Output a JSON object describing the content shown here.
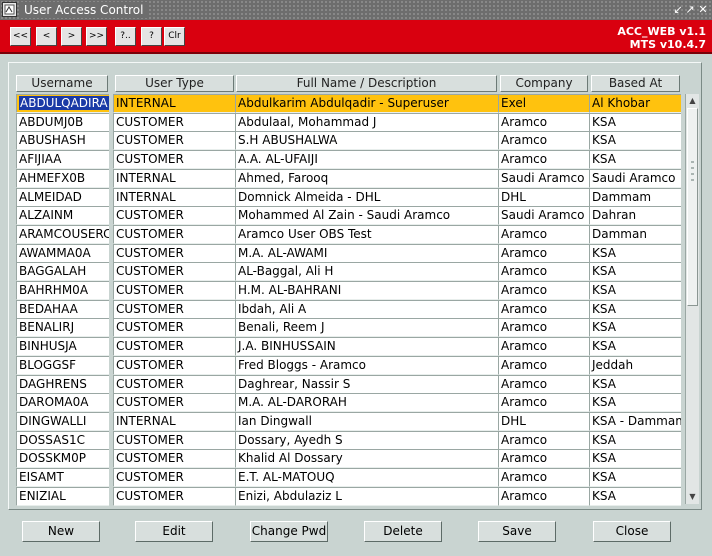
{
  "window": {
    "title": "User Access Control",
    "app_icon": "form-icon",
    "controls": [
      "↙",
      "↗",
      "✕"
    ]
  },
  "toolbar": {
    "buttons": [
      {
        "icon": "first-record-icon",
        "label": "<<"
      },
      {
        "icon": "previous-record-icon",
        "label": "<"
      },
      {
        "icon": "next-record-icon",
        "label": ">"
      },
      {
        "icon": "last-record-icon",
        "label": ">>"
      },
      {
        "icon": "query-help-icon",
        "label": "?.."
      },
      {
        "icon": "help-icon",
        "label": "?"
      },
      {
        "icon": "clear-icon",
        "label": "Clr"
      }
    ],
    "version_line1": "ACC_WEB v1.1",
    "version_line2": "MTS v10.4.7",
    "accent_color": "#d9000f"
  },
  "table": {
    "headers": [
      "Username",
      "User Type",
      "Full Name /  Description",
      "Company",
      "Based At"
    ],
    "selected_row": 0,
    "selected_color": "#ffc20e",
    "rows": [
      [
        "ABDULQADIRA",
        "INTERNAL",
        "Abdulkarim  Abdulqadir - Superuser",
        "Exel",
        "Al Khobar"
      ],
      [
        "ABDUMJ0B",
        "CUSTOMER",
        "Abdulaal, Mohammad J",
        "Aramco",
        "KSA"
      ],
      [
        "ABUSHASH",
        "CUSTOMER",
        "S.H ABUSHALWA",
        "Aramco",
        "KSA"
      ],
      [
        "AFIJIAA",
        "CUSTOMER",
        "A.A. AL-UFAIJI",
        "Aramco",
        "KSA"
      ],
      [
        "AHMEFX0B",
        "INTERNAL",
        "Ahmed, Farooq",
        "Saudi Aramco",
        "Saudi Aramco"
      ],
      [
        "ALMEIDAD",
        "INTERNAL",
        "Domnick Almeida - DHL",
        "DHL",
        "Dammam"
      ],
      [
        "ALZAINM",
        "CUSTOMER",
        "Mohammed Al Zain - Saudi Aramco",
        "Saudi Aramco",
        "Dahran"
      ],
      [
        "ARAMCOUSERC",
        "CUSTOMER",
        "Aramco User OBS Test",
        "Aramco",
        "Damman"
      ],
      [
        "AWAMMA0A",
        "CUSTOMER",
        "M.A. AL-AWAMI",
        "Aramco",
        "KSA"
      ],
      [
        "BAGGALAH",
        "CUSTOMER",
        "AL-Baggal, Ali H",
        "Aramco",
        "KSA"
      ],
      [
        "BAHRHM0A",
        "CUSTOMER",
        "H.M. AL-BAHRANI",
        "Aramco",
        "KSA"
      ],
      [
        "BEDAHAA",
        "CUSTOMER",
        "Ibdah, Ali A",
        "Aramco",
        "KSA"
      ],
      [
        "BENALIRJ",
        "CUSTOMER",
        "Benali, Reem J",
        "Aramco",
        "KSA"
      ],
      [
        "BINHUSJA",
        "CUSTOMER",
        "J.A. BINHUSSAIN",
        "Aramco",
        "KSA"
      ],
      [
        "BLOGGSF",
        "CUSTOMER",
        "Fred Bloggs - Aramco",
        "Aramco",
        "Jeddah"
      ],
      [
        "DAGHRENS",
        "CUSTOMER",
        "Daghrear, Nassir S",
        "Aramco",
        "KSA"
      ],
      [
        "DAROMA0A",
        "CUSTOMER",
        "M.A. AL-DARORAH",
        "Aramco",
        "KSA"
      ],
      [
        "DINGWALLI",
        "INTERNAL",
        "Ian Dingwall",
        "DHL",
        "KSA - Dammam"
      ],
      [
        "DOSSAS1C",
        "CUSTOMER",
        "Dossary, Ayedh S",
        "Aramco",
        "KSA"
      ],
      [
        "DOSSKM0P",
        "CUSTOMER",
        "Khalid Al Dossary",
        "Aramco",
        "KSA"
      ],
      [
        "EISAMT",
        "CUSTOMER",
        "E.T. AL-MATOUQ",
        "Aramco",
        "KSA"
      ],
      [
        "ENIZIAL",
        "CUSTOMER",
        "Enizi, Abdulaziz L",
        "Aramco",
        "KSA"
      ]
    ]
  },
  "scrollbar": {
    "up_icon": "scroll-up-icon",
    "down_icon": "scroll-down-icon",
    "up": "▲",
    "down": "▼"
  },
  "buttons": [
    "New",
    "Edit",
    "Change Pwd",
    "Delete",
    "Save",
    "Close"
  ]
}
